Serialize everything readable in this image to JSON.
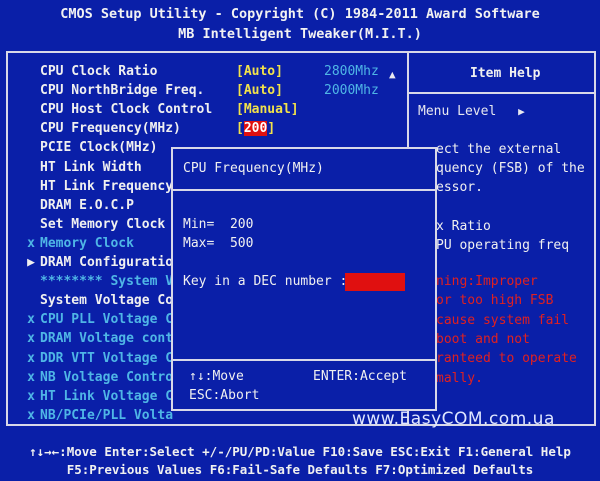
{
  "header": {
    "line1": "CMOS Setup Utility - Copyright (C) 1984-2011 Award Software",
    "line2": "MB Intelligent Tweaker(M.I.T.)"
  },
  "settings": [
    {
      "mark": "",
      "label": "CPU Clock Ratio",
      "value": "[Auto]",
      "extra": "2800Mhz",
      "color": "white"
    },
    {
      "mark": "",
      "label": "CPU NorthBridge Freq.",
      "value": "[Auto]",
      "extra": "2000Mhz",
      "color": "white"
    },
    {
      "mark": "",
      "label": "CPU Host Clock Control",
      "value": "[Manual]",
      "extra": "",
      "color": "white"
    },
    {
      "mark": "",
      "label": "CPU Frequency(MHz)",
      "value_pre": "[",
      "value_hot": "200",
      "value_post": "]",
      "color": "white"
    },
    {
      "mark": "",
      "label": "PCIE Clock(MHz)",
      "color": "white"
    },
    {
      "mark": "",
      "label": "HT Link Width",
      "color": "white"
    },
    {
      "mark": "",
      "label": "HT Link Frequency",
      "color": "white"
    },
    {
      "mark": "",
      "label": "DRAM E.O.C.P",
      "color": "white"
    },
    {
      "mark": "",
      "label": "Set Memory Clock",
      "color": "white"
    },
    {
      "mark": "x",
      "label": "Memory Clock",
      "color": "cyan"
    },
    {
      "mark": "▶",
      "label": "DRAM Configuratio",
      "color": "white"
    },
    {
      "mark": "",
      "label": "******** System V",
      "color": "cyan"
    },
    {
      "mark": "",
      "label": "System Voltage Co",
      "color": "white"
    },
    {
      "mark": "x",
      "label": "CPU PLL Voltage C",
      "color": "cyan"
    },
    {
      "mark": "x",
      "label": "DRAM Voltage cont",
      "color": "cyan"
    },
    {
      "mark": "x",
      "label": "DDR VTT Voltage C",
      "color": "cyan"
    },
    {
      "mark": "x",
      "label": "NB Voltage Contro",
      "color": "cyan"
    },
    {
      "mark": "x",
      "label": "HT Link Voltage C",
      "color": "cyan"
    },
    {
      "mark": "x",
      "label": "NB/PCIe/PLL Volta",
      "color": "cyan"
    }
  ],
  "help": {
    "title": "Item Help",
    "menu_level": "Menu Level",
    "menu_level_arrow": "▶",
    "lines_white": [
      "ect the external",
      "quency (FSB) of the",
      "essor."
    ],
    "lines_white2": [
      "x Ratio",
      "PU operating freq"
    ],
    "lines_red": [
      "ning:Improper",
      " or too high FSB",
      " cause system fail",
      "boot and not",
      "ranteed to operate",
      "mally."
    ]
  },
  "dialog": {
    "title": "CPU Frequency(MHz)",
    "min_label": "Min=",
    "min_value": "200",
    "max_label": "Max=",
    "max_value": "500",
    "prompt": "Key in a DEC number :",
    "input_value": "",
    "move_hint": "↑↓:Move",
    "enter_hint": "ENTER:Accept",
    "esc_hint": "ESC:Abort"
  },
  "footer": {
    "line1": "↑↓→←:Move  Enter:Select  +/-/PU/PD:Value  F10:Save  ESC:Exit  F1:General Help",
    "line2": "F5:Previous Values  F6:Fail-Safe Defaults  F7:Optimized Defaults"
  },
  "watermark": "www.EasyCOM.com.ua",
  "colors": {
    "background": "#0a1fa8",
    "value_yellow": "#f2e24a",
    "disabled_cyan": "#4fb6e6",
    "warning_red": "#e02020",
    "input_red": "#e01010"
  },
  "icons": {
    "scroll_up": "up-triangle-icon",
    "submenu": "right-triangle-icon"
  }
}
